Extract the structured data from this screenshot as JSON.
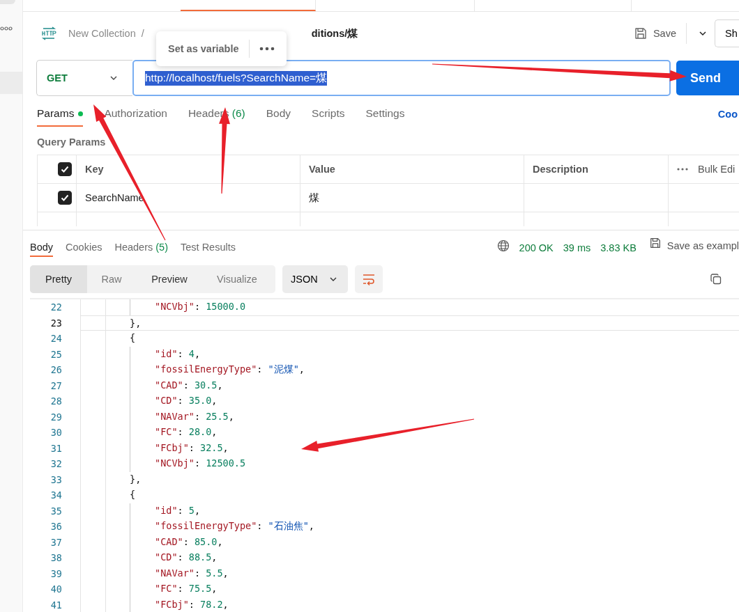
{
  "request": {
    "collection": "New Collection",
    "separator": "/",
    "title": "ditions/煤",
    "save": "Save",
    "share": "Sh"
  },
  "popup": {
    "action": "Set as variable"
  },
  "method": "GET",
  "url": "http://localhost/fuels?SearchName=煤",
  "url_selected": true,
  "send": "Send",
  "request_tabs": [
    {
      "label": "Params",
      "dot": true,
      "selected": true
    },
    {
      "label": "Authorization",
      "dot": false,
      "selected": false
    },
    {
      "label": "Headers",
      "count": "(6)",
      "dot": false,
      "selected": false
    },
    {
      "label": "Body",
      "dot": false,
      "selected": false
    },
    {
      "label": "Scripts",
      "dot": false,
      "selected": false
    },
    {
      "label": "Settings",
      "dot": false,
      "selected": false
    }
  ],
  "code_link": "Coo",
  "query_params": {
    "title": "Query Params",
    "columns": [
      "Key",
      "Value",
      "Description"
    ],
    "bulk_edit": "Bulk Edi",
    "header_checked": true,
    "rows": [
      {
        "checked": true,
        "key": "SearchName",
        "value": "煤"
      }
    ]
  },
  "response": {
    "tabs": [
      {
        "label": "Body",
        "selected": true
      },
      {
        "label": "Cookies",
        "selected": false
      },
      {
        "label": "Headers",
        "count": "(5)",
        "selected": false
      },
      {
        "label": "Test Results",
        "selected": false
      }
    ],
    "status": "200 OK",
    "time": "39 ms",
    "size": "3.83 KB",
    "save_example": "Save as exampl",
    "views": [
      {
        "label": "Pretty",
        "selected": true
      },
      {
        "label": "Raw",
        "selected": false
      },
      {
        "label": "Preview",
        "selected": false
      },
      {
        "label": "Visualize",
        "selected": false
      }
    ],
    "format": "JSON",
    "lines": [
      {
        "number": "22",
        "kind": "number",
        "key": "\"NCVbj\"",
        "sep": ": ",
        "value": "15000.0",
        "current": false
      },
      {
        "number": "23",
        "kind": "brace",
        "text": "},",
        "current": true
      },
      {
        "number": "24",
        "kind": "brace",
        "text": "{",
        "current": false
      },
      {
        "number": "25",
        "kind": "number",
        "key": "\"id\"",
        "sep": ": ",
        "value": "4",
        "end": ",",
        "current": false
      },
      {
        "number": "26",
        "kind": "string",
        "key": "\"fossilEnergyType\"",
        "sep": ": ",
        "value": "\"泥煤\"",
        "end": ",",
        "current": false
      },
      {
        "number": "27",
        "kind": "number",
        "key": "\"CAD\"",
        "sep": ": ",
        "value": "30.5",
        "end": ",",
        "current": false
      },
      {
        "number": "28",
        "kind": "number",
        "key": "\"CD\"",
        "sep": ": ",
        "value": "35.0",
        "end": ",",
        "current": false
      },
      {
        "number": "29",
        "kind": "number",
        "key": "\"NAVar\"",
        "sep": ": ",
        "value": "25.5",
        "end": ",",
        "current": false
      },
      {
        "number": "30",
        "kind": "number",
        "key": "\"FC\"",
        "sep": ": ",
        "value": "28.0",
        "end": ",",
        "current": false
      },
      {
        "number": "31",
        "kind": "number",
        "key": "\"FCbj\"",
        "sep": ": ",
        "value": "32.5",
        "end": ",",
        "current": false
      },
      {
        "number": "32",
        "kind": "number",
        "key": "\"NCVbj\"",
        "sep": ": ",
        "value": "12500.5",
        "current": false
      },
      {
        "number": "33",
        "kind": "brace",
        "text": "},",
        "current": false
      },
      {
        "number": "34",
        "kind": "brace",
        "text": "{",
        "current": false
      },
      {
        "number": "35",
        "kind": "number",
        "key": "\"id\"",
        "sep": ": ",
        "value": "5",
        "end": ",",
        "current": false
      },
      {
        "number": "36",
        "kind": "string",
        "key": "\"fossilEnergyType\"",
        "sep": ": ",
        "value": "\"石油焦\"",
        "end": ",",
        "current": false
      },
      {
        "number": "37",
        "kind": "number",
        "key": "\"CAD\"",
        "sep": ": ",
        "value": "85.0",
        "end": ",",
        "current": false
      },
      {
        "number": "38",
        "kind": "number",
        "key": "\"CD\"",
        "sep": ": ",
        "value": "88.5",
        "end": ",",
        "current": false
      },
      {
        "number": "39",
        "kind": "number",
        "key": "\"NAVar\"",
        "sep": ": ",
        "value": "5.5",
        "end": ",",
        "current": false
      },
      {
        "number": "40",
        "kind": "number",
        "key": "\"FC\"",
        "sep": ": ",
        "value": "75.5",
        "end": ",",
        "current": false
      },
      {
        "number": "41",
        "kind": "number",
        "key": "\"FCbj\"",
        "sep": ": ",
        "value": "78.2",
        "end": ",",
        "current": false
      }
    ]
  }
}
